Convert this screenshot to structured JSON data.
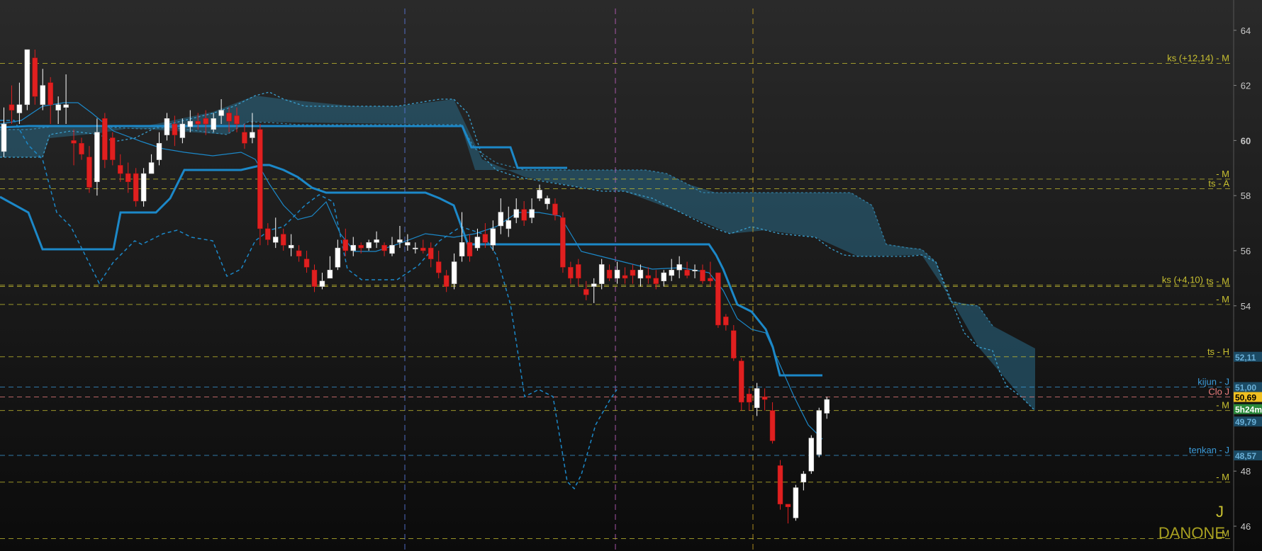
{
  "chart_data": {
    "type": "candlestick",
    "instrument": "DANONE",
    "period_marker": "J",
    "ylim": [
      45.1,
      65.1
    ],
    "y_ticks": [
      46,
      48,
      54,
      56,
      58,
      60,
      62,
      64
    ],
    "y_tick_bold": 60,
    "colors": {
      "up": "#ffffff",
      "down": "#e02020",
      "cloud": "#2a6a86",
      "kijun": "#1c88c8",
      "tenkan": "#1c88c8",
      "chikou": "#1c88c8"
    },
    "levels": [
      {
        "label": "ks (+12,14) - M",
        "price": 62.8,
        "color": "#c8c030"
      },
      {
        "label": "- M",
        "price": 58.6,
        "color": "#c8c030"
      },
      {
        "label": "ts - A",
        "price": 58.25,
        "color": "#c8c030"
      },
      {
        "label": "ks (+4,10)",
        "price": 54.75,
        "color": "#c8c030"
      },
      {
        "label": "ts - M",
        "price": 54.7,
        "color": "#c8c030"
      },
      {
        "label": "- M",
        "price": 54.05,
        "color": "#c8c030"
      },
      {
        "label": "ts - H",
        "price": 52.15,
        "color": "#c8c030"
      },
      {
        "label": "kijun - J",
        "price": 51.05,
        "color": "#3a9ad8"
      },
      {
        "label": "Clo J",
        "price": 50.69,
        "color": "#f08080"
      },
      {
        "label": "- M",
        "price": 50.2,
        "color": "#c8c030"
      },
      {
        "label": "tenkan - J",
        "price": 48.57,
        "color": "#3a9ad8"
      },
      {
        "label": "- M",
        "price": 47.6,
        "color": "#c8c030"
      },
      {
        "label": "M",
        "price": 45.55,
        "color": "#c8c030"
      }
    ],
    "price_tags": [
      {
        "text": "52,11",
        "price": 52.15,
        "bg": "#1b4a64",
        "fg": "#6ab0d8"
      },
      {
        "text": "51,00",
        "price": 51.05,
        "bg": "#1b4a64",
        "fg": "#6ab0d8"
      },
      {
        "text": "50,69",
        "price": 50.69,
        "bg": "#f0c020",
        "fg": "#000000"
      },
      {
        "text": "5h24m",
        "price": 50.25,
        "bg": "#2a8a3a",
        "fg": "#ffffff"
      },
      {
        "text": "49,79",
        "price": 49.8,
        "bg": "#1b4a64",
        "fg": "#6ab0d8"
      },
      {
        "text": "48,57",
        "price": 48.57,
        "bg": "#1b4a64",
        "fg": "#6ab0d8"
      }
    ],
    "candles": [
      [
        0,
        59.6,
        60.6,
        59.4,
        61.2
      ],
      [
        1,
        61.3,
        61.1,
        60.6,
        62.0
      ],
      [
        2,
        61.0,
        61.3,
        60.6,
        62.1
      ],
      [
        3,
        61.3,
        63.3,
        61.1,
        63.3
      ],
      [
        4,
        63.0,
        61.6,
        61.3,
        63.3
      ],
      [
        5,
        61.3,
        62.0,
        61.1,
        62.6
      ],
      [
        6,
        62.1,
        61.3,
        60.6,
        62.3
      ],
      [
        7,
        61.1,
        61.3,
        60.6,
        61.6
      ],
      [
        8,
        61.2,
        61.3,
        60.6,
        62.4
      ],
      [
        9,
        60.0,
        59.9,
        59.1,
        60.4
      ],
      [
        10,
        59.9,
        59.5,
        59.3,
        60.1
      ],
      [
        11,
        59.4,
        58.3,
        58.1,
        59.8
      ],
      [
        12,
        58.5,
        60.3,
        58.0,
        60.8
      ],
      [
        13,
        60.8,
        59.3,
        59.0,
        61.0
      ],
      [
        14,
        60.1,
        59.3,
        59.1,
        60.3
      ],
      [
        15,
        59.1,
        58.8,
        58.5,
        59.5
      ],
      [
        16,
        58.8,
        58.5,
        58.1,
        59.2
      ],
      [
        17,
        58.8,
        57.8,
        57.6,
        59.0
      ],
      [
        18,
        57.8,
        58.8,
        57.6,
        59.0
      ],
      [
        19,
        58.8,
        59.2,
        58.8,
        59.5
      ],
      [
        20,
        59.3,
        59.9,
        59.1,
        60.3
      ],
      [
        21,
        60.2,
        60.8,
        60.0,
        61.0
      ],
      [
        22,
        60.6,
        60.2,
        59.8,
        60.9
      ],
      [
        23,
        60.1,
        60.6,
        59.9,
        60.8
      ],
      [
        24,
        60.5,
        60.7,
        60.3,
        61.1
      ],
      [
        25,
        60.7,
        60.6,
        60.4,
        61.0
      ],
      [
        26,
        60.8,
        60.6,
        60.2,
        61.1
      ],
      [
        27,
        60.4,
        60.8,
        60.3,
        61.0
      ],
      [
        28,
        60.9,
        61.1,
        60.6,
        61.5
      ],
      [
        29,
        61.0,
        60.7,
        60.3,
        61.2
      ],
      [
        30,
        60.9,
        60.6,
        60.3,
        61.2
      ],
      [
        31,
        60.3,
        59.9,
        59.7,
        60.6
      ],
      [
        32,
        60.1,
        60.3,
        59.9,
        61.0
      ],
      [
        33,
        60.4,
        56.8,
        56.2,
        60.6
      ],
      [
        34,
        56.8,
        56.4,
        56.2,
        57.0
      ],
      [
        35,
        56.3,
        56.5,
        56.1,
        57.2
      ],
      [
        36,
        56.6,
        56.2,
        56.0,
        56.8
      ],
      [
        37,
        56.1,
        56.2,
        55.8,
        56.6
      ],
      [
        38,
        56.0,
        55.8,
        55.6,
        56.2
      ],
      [
        39,
        55.7,
        55.4,
        55.2,
        56.0
      ],
      [
        40,
        55.3,
        54.7,
        54.5,
        55.5
      ],
      [
        41,
        54.7,
        54.9,
        54.6,
        55.2
      ],
      [
        42,
        55.0,
        55.3,
        55.0,
        55.8
      ],
      [
        43,
        55.4,
        56.1,
        55.3,
        56.4
      ],
      [
        44,
        56.4,
        56.0,
        55.8,
        56.8
      ],
      [
        45,
        56.0,
        56.2,
        55.8,
        56.5
      ],
      [
        46,
        56.2,
        56.1,
        55.9,
        56.3
      ],
      [
        47,
        56.1,
        56.3,
        56.0,
        56.4
      ],
      [
        48,
        56.3,
        56.4,
        56.1,
        56.7
      ],
      [
        49,
        56.2,
        56.0,
        55.8,
        56.3
      ],
      [
        50,
        55.9,
        56.2,
        55.8,
        56.5
      ],
      [
        51,
        56.3,
        56.4,
        56.1,
        56.9
      ],
      [
        52,
        56.2,
        56.3,
        56.0,
        56.6
      ],
      [
        53,
        56.1,
        56.1,
        55.9,
        56.3
      ],
      [
        54,
        56.1,
        56.0,
        55.9,
        56.4
      ],
      [
        55,
        56.1,
        55.7,
        55.4,
        56.3
      ],
      [
        56,
        55.6,
        55.2,
        55.0,
        56.0
      ],
      [
        57,
        55.1,
        54.7,
        54.5,
        55.3
      ],
      [
        58,
        54.8,
        55.6,
        54.6,
        55.9
      ],
      [
        59,
        55.8,
        56.3,
        55.6,
        57.4
      ],
      [
        60,
        56.3,
        55.8,
        55.6,
        56.6
      ],
      [
        61,
        56.1,
        56.5,
        56.0,
        56.8
      ],
      [
        62,
        56.6,
        56.3,
        56.1,
        57.0
      ],
      [
        63,
        56.2,
        56.8,
        56.0,
        57.1
      ],
      [
        64,
        56.9,
        57.4,
        56.6,
        57.9
      ],
      [
        65,
        56.8,
        57.1,
        56.5,
        57.6
      ],
      [
        66,
        57.2,
        57.5,
        57.0,
        57.9
      ],
      [
        67,
        57.5,
        57.1,
        56.9,
        57.8
      ],
      [
        68,
        57.2,
        57.5,
        57.0,
        57.9
      ],
      [
        69,
        57.9,
        58.2,
        57.8,
        58.4
      ],
      [
        70,
        57.7,
        57.9,
        57.5,
        58.0
      ],
      [
        71,
        57.7,
        57.3,
        57.1,
        57.9
      ],
      [
        72,
        57.2,
        55.4,
        55.2,
        57.4
      ],
      [
        73,
        55.4,
        55.0,
        54.8,
        55.6
      ],
      [
        74,
        55.5,
        55.0,
        54.7,
        55.7
      ],
      [
        75,
        54.6,
        54.4,
        54.2,
        54.9
      ],
      [
        76,
        54.7,
        54.8,
        54.1,
        55.0
      ],
      [
        77,
        54.8,
        55.5,
        54.6,
        55.7
      ],
      [
        78,
        55.3,
        55.0,
        54.9,
        55.5
      ],
      [
        79,
        55.0,
        55.3,
        54.8,
        55.6
      ],
      [
        80,
        55.1,
        55.0,
        54.8,
        55.4
      ],
      [
        81,
        55.3,
        55.1,
        54.8,
        55.5
      ],
      [
        82,
        55.0,
        55.3,
        54.7,
        55.5
      ],
      [
        83,
        55.1,
        55.0,
        54.8,
        55.4
      ],
      [
        84,
        55.0,
        54.8,
        54.6,
        55.3
      ],
      [
        85,
        54.9,
        55.2,
        54.7,
        55.3
      ],
      [
        86,
        55.1,
        55.3,
        54.9,
        55.7
      ],
      [
        87,
        55.3,
        55.5,
        55.0,
        55.8
      ],
      [
        88,
        55.3,
        55.1,
        55.0,
        55.6
      ],
      [
        89,
        55.3,
        55.3,
        55.0,
        55.5
      ],
      [
        90,
        55.3,
        54.9,
        54.8,
        55.5
      ],
      [
        91,
        55.0,
        54.9,
        54.7,
        55.6
      ],
      [
        92,
        55.2,
        53.3,
        53.2,
        55.2
      ],
      [
        93,
        53.6,
        53.3,
        53.1,
        53.7
      ],
      [
        94,
        53.1,
        52.1,
        52.0,
        53.3
      ],
      [
        95,
        52.0,
        50.5,
        50.2,
        52.1
      ],
      [
        96,
        50.8,
        50.5,
        50.2,
        51.0
      ],
      [
        97,
        50.3,
        51.0,
        50.0,
        51.2
      ],
      [
        98,
        50.7,
        50.6,
        50.2,
        51.0
      ],
      [
        99,
        50.2,
        49.1,
        49.0,
        50.5
      ],
      [
        100,
        48.2,
        46.8,
        46.6,
        48.4
      ],
      [
        101,
        46.8,
        46.7,
        46.1,
        46.8
      ],
      [
        102,
        46.3,
        47.4,
        46.2,
        47.5
      ],
      [
        103,
        47.6,
        47.9,
        47.3,
        48.0
      ],
      [
        104,
        48.0,
        49.2,
        47.9,
        49.3
      ],
      [
        105,
        48.6,
        50.2,
        48.5,
        50.3
      ],
      [
        106,
        50.1,
        50.6,
        49.9,
        50.7
      ]
    ]
  }
}
